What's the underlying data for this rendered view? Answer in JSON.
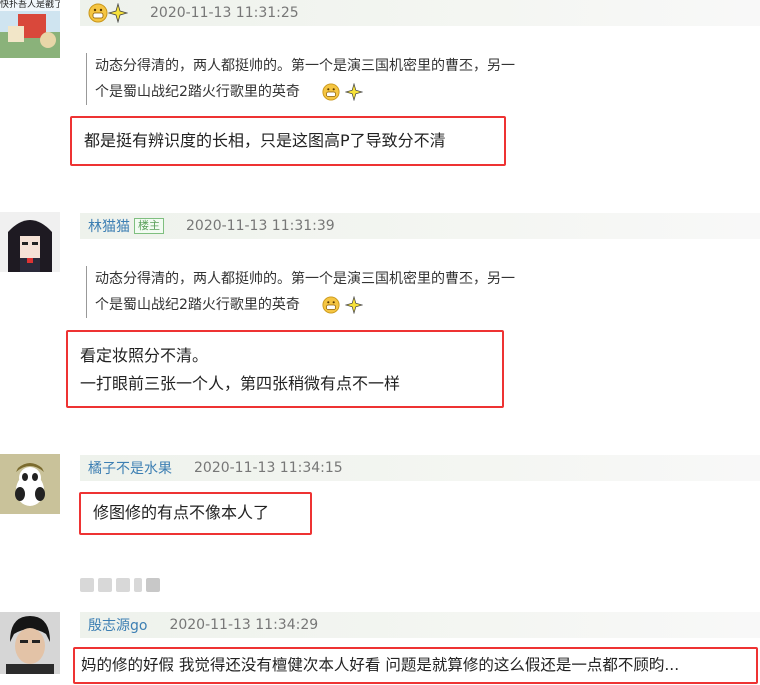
{
  "comments": [
    {
      "user": "",
      "badge": "",
      "time": "2020-11-13 11:31:25",
      "quote_line1": "动态分得清的，两人都挺帅的。第一个是演三国机密里的曹丕，另一",
      "quote_line2": "个是蜀山战纪2踏火行歌里的英奇",
      "reply_lines": [
        "都是挺有辨识度的长相，只是这图高P了导致分不清"
      ]
    },
    {
      "user": "林猫猫",
      "badge": "楼主",
      "time": "2020-11-13 11:31:39",
      "quote_line1": "动态分得清的，两人都挺帅的。第一个是演三国机密里的曹丕，另一",
      "quote_line2": "个是蜀山战纪2踏火行歌里的英奇",
      "reply_lines": [
        "看定妆照分不清。",
        "一打眼前三张一个人，第四张稍微有点不一样"
      ]
    },
    {
      "user": "橘子不是水果",
      "badge": "",
      "time": "2020-11-13 11:34:15",
      "reply_lines": [
        "修图修的有点不像本人了"
      ]
    },
    {
      "user": "殷志源go",
      "badge": "",
      "time": "2020-11-13 11:34:29",
      "reply_lines": [
        "妈的修的好假 我觉得还没有檀健次本人好看 问题是就算修的这么假还是一点都不顾昀..."
      ]
    }
  ],
  "avatar1_text": "快扑吾人是戳了",
  "colors": {
    "highlight": "#ee3333",
    "user": "#3d7fb3"
  },
  "icons": [
    "grin-emoji-icon",
    "sparkle-emoji-icon"
  ]
}
